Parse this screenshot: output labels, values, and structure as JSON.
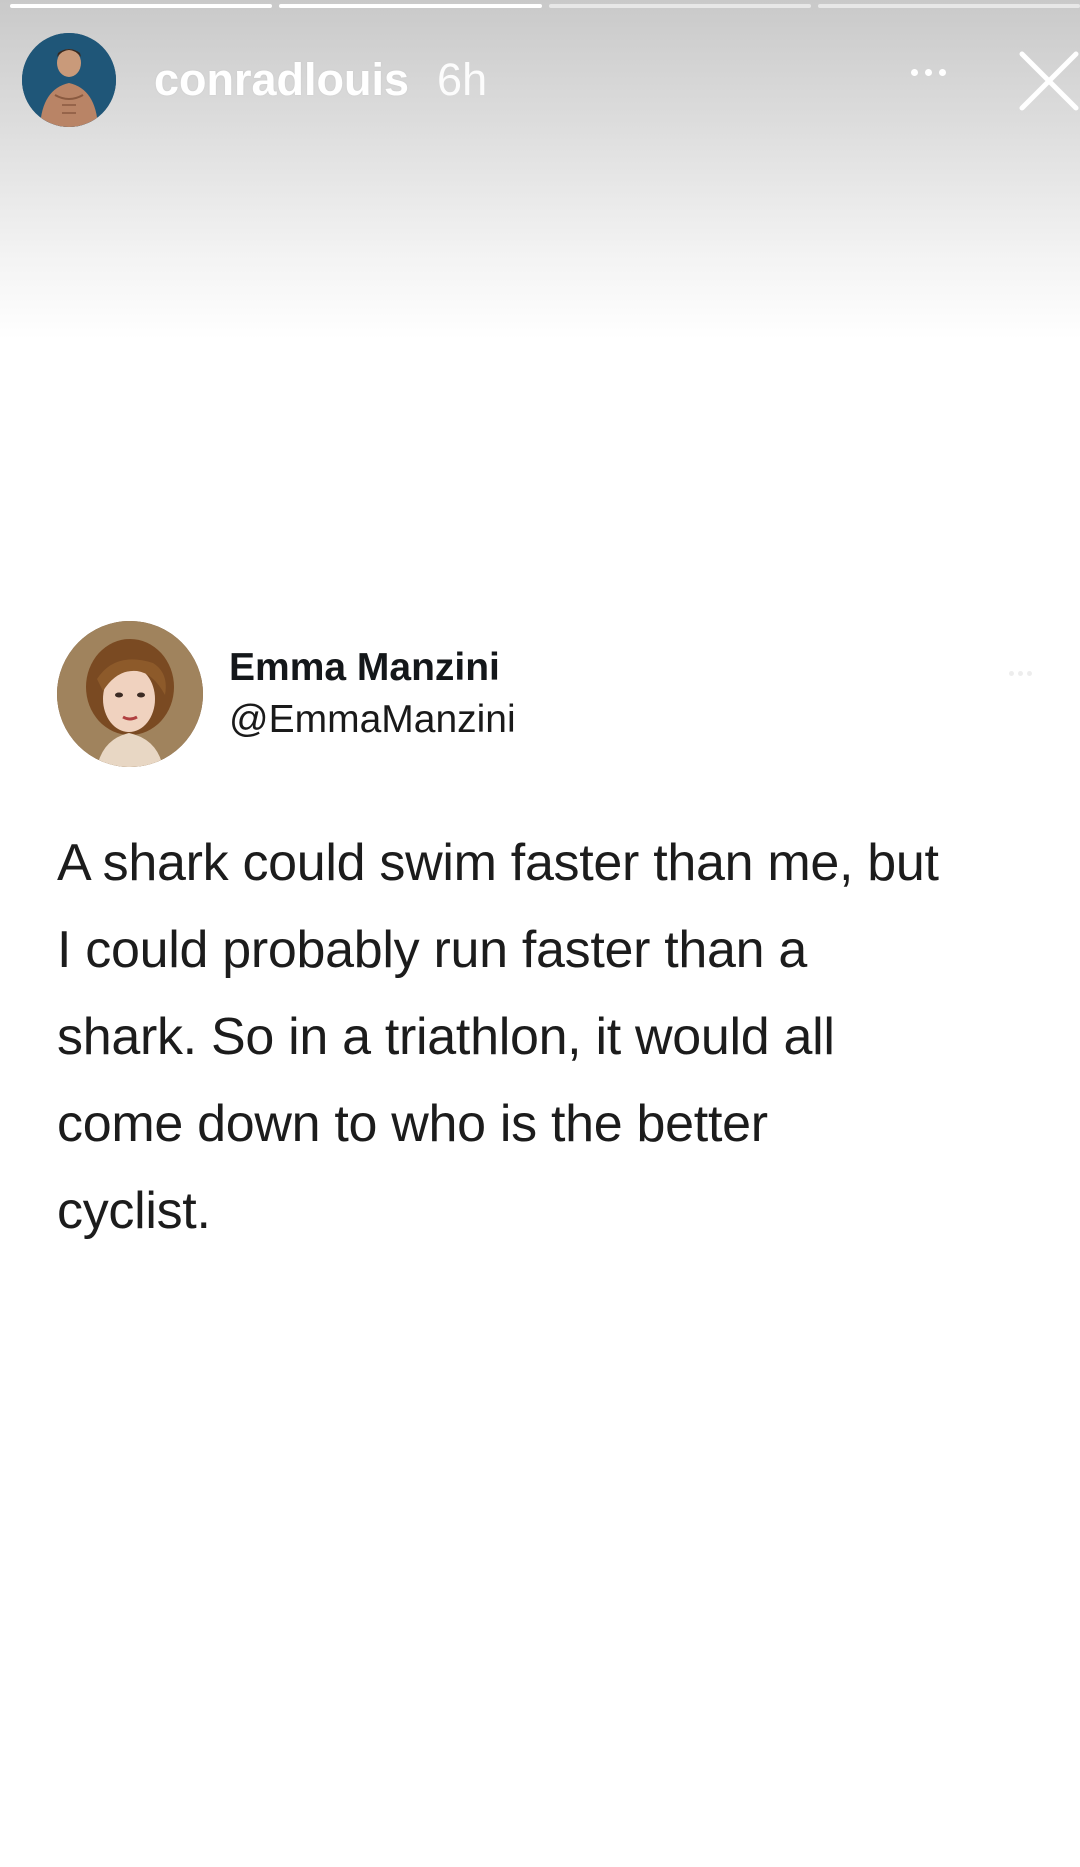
{
  "story": {
    "progress": [
      1,
      1,
      0,
      0
    ],
    "header": {
      "username": "conradlouis",
      "time": "6h"
    },
    "icons": {
      "more": "more-horizontal-icon",
      "close": "close-icon"
    }
  },
  "tweet": {
    "name": "Emma Manzini",
    "handle": "@EmmaManzini",
    "text_lines": [
      "A shark could swim faster than me, but",
      "I could probably run faster than a",
      "shark. So in a triathlon, it would all",
      "come down to who is the better",
      "cyclist."
    ]
  }
}
